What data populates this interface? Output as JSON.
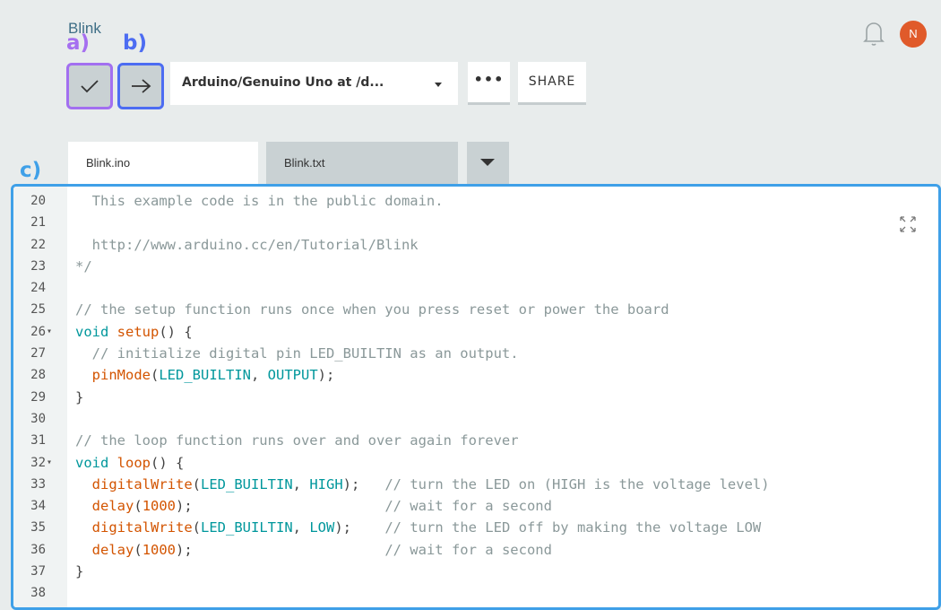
{
  "header": {
    "sketch_title": "Blink",
    "avatar_initial": "N",
    "avatar_color": "#e05a2a"
  },
  "annotations": {
    "a": "a)",
    "b": "b)",
    "c": "c)"
  },
  "toolbar": {
    "verify_icon": "check-icon",
    "upload_icon": "arrow-right-icon",
    "board_select_value": "Arduino/Genuino Uno at /d...",
    "more_label": "•••",
    "share_label": "SHARE"
  },
  "tabs": [
    {
      "label": "Blink.ino",
      "active": true
    },
    {
      "label": "Blink.txt",
      "active": false
    }
  ],
  "editor": {
    "lines": [
      {
        "n": "20",
        "fold": "",
        "html": "<span class=\"cm\">  This example code is in the public domain.</span>"
      },
      {
        "n": "21",
        "fold": "",
        "html": ""
      },
      {
        "n": "22",
        "fold": "",
        "html": "<span class=\"cm\">  http://www.arduino.cc/en/Tutorial/Blink</span>"
      },
      {
        "n": "23",
        "fold": "",
        "html": "<span class=\"cm\">*/</span>"
      },
      {
        "n": "24",
        "fold": "",
        "html": ""
      },
      {
        "n": "25",
        "fold": "",
        "html": "<span class=\"cm\">// the setup function runs once when you press reset or power the board</span>"
      },
      {
        "n": "26",
        "fold": "▾",
        "html": "<span class=\"kw\">void</span> <span class=\"fn\">setup</span>() {"
      },
      {
        "n": "27",
        "fold": "",
        "html": "<span class=\"cm\">  // initialize digital pin LED_BUILTIN as an output.</span>"
      },
      {
        "n": "28",
        "fold": "",
        "html": "  <span class=\"fn\">pinMode</span>(<span class=\"cst\">LED_BUILTIN</span>, <span class=\"cst\">OUTPUT</span>);"
      },
      {
        "n": "29",
        "fold": "",
        "html": "}"
      },
      {
        "n": "30",
        "fold": "",
        "html": ""
      },
      {
        "n": "31",
        "fold": "",
        "html": "<span class=\"cm\">// the loop function runs over and over again forever</span>"
      },
      {
        "n": "32",
        "fold": "▾",
        "html": "<span class=\"kw\">void</span> <span class=\"fn\">loop</span>() {"
      },
      {
        "n": "33",
        "fold": "",
        "html": "  <span class=\"fn\">digitalWrite</span>(<span class=\"cst\">LED_BUILTIN</span>, <span class=\"cst\">HIGH</span>);   <span class=\"cm\">// turn the LED on (HIGH is the voltage level)</span>"
      },
      {
        "n": "34",
        "fold": "",
        "html": "  <span class=\"fn\">delay</span>(<span class=\"fn\">1000</span>);                       <span class=\"cm\">// wait for a second</span>"
      },
      {
        "n": "35",
        "fold": "",
        "html": "  <span class=\"fn\">digitalWrite</span>(<span class=\"cst\">LED_BUILTIN</span>, <span class=\"cst\">LOW</span>);    <span class=\"cm\">// turn the LED off by making the voltage LOW</span>"
      },
      {
        "n": "36",
        "fold": "",
        "html": "  <span class=\"fn\">delay</span>(<span class=\"fn\">1000</span>);                       <span class=\"cm\">// wait for a second</span>"
      },
      {
        "n": "37",
        "fold": "",
        "html": "}"
      },
      {
        "n": "38",
        "fold": "",
        "html": ""
      }
    ]
  },
  "colors": {
    "background": "#e8ecec",
    "verify_outline": "#a26ff0",
    "upload_outline": "#4c6cf2",
    "editor_outline": "#3fa0e8",
    "comment": "#8a9899",
    "keyword": "#00979c",
    "function": "#d35400"
  }
}
